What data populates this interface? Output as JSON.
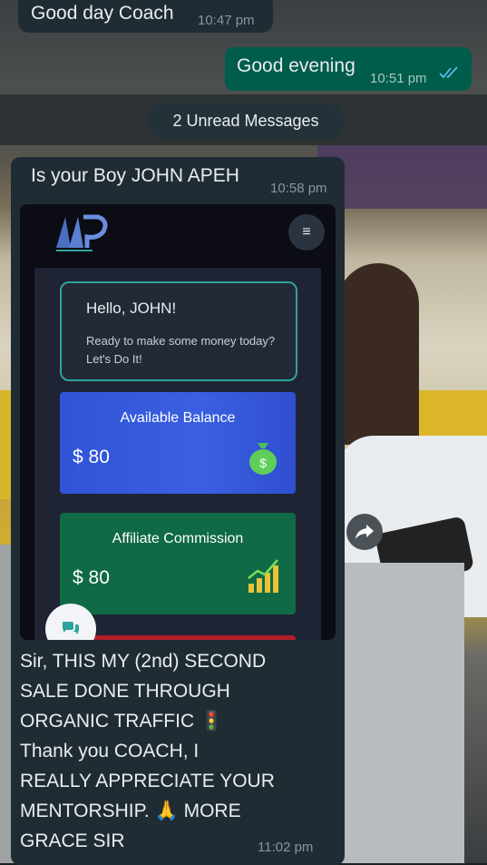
{
  "messages": {
    "m1": {
      "text": "Good day Coach",
      "time": "10:47 pm"
    },
    "m2": {
      "text": "Good evening",
      "time": "10:51 pm"
    },
    "unread": "2 Unread Messages",
    "m3": {
      "text": "Is your Boy JOHN APEH",
      "time": "10:58 pm",
      "screenshot": {
        "hello_title": "Hello, JOHN!",
        "hello_sub": "Ready to make some money today? Let's Do It!",
        "balance_label": "Available Balance",
        "balance_value": "$ 80",
        "affiliate_label": "Affiliate Commission",
        "affiliate_value": "$ 80",
        "menu_icon": "≡"
      },
      "caption_l1": "Sir, THIS MY (2nd)  SECOND",
      "caption_l2": "SALE DONE THROUGH",
      "caption_l3": "ORGANIC TRAFFIC 🚦",
      "caption_l4": "Thank you COACH, I",
      "caption_l5": "REALLY APPRECIATE YOUR",
      "caption_l6": "MENTORSHIP.     🙏 MORE",
      "caption_l7": "GRACE SIR",
      "caption_time": "11:02 pm"
    }
  },
  "colors": {
    "incoming": "#202c33",
    "outgoing": "#005c4b",
    "read_ticks": "#53bdeb"
  }
}
